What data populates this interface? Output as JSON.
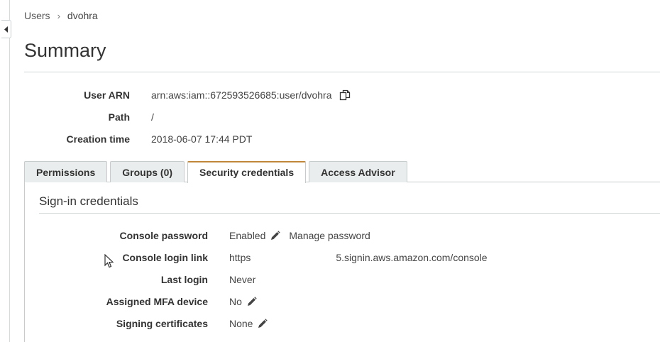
{
  "breadcrumb": {
    "root": "Users",
    "separator": "›",
    "current": "dvohra"
  },
  "page": {
    "title": "Summary"
  },
  "summary": {
    "rows": [
      {
        "label": "User ARN",
        "value": "arn:aws:iam::672593526685:user/dvohra"
      },
      {
        "label": "Path",
        "value": "/"
      },
      {
        "label": "Creation time",
        "value": "2018-06-07 17:44 PDT"
      }
    ]
  },
  "tabs": [
    {
      "label": "Permissions",
      "active": false
    },
    {
      "label": "Groups (0)",
      "active": false
    },
    {
      "label": "Security credentials",
      "active": true
    },
    {
      "label": "Access Advisor",
      "active": false
    }
  ],
  "sign_in": {
    "title": "Sign-in credentials",
    "console_password": {
      "label": "Console password",
      "value": "Enabled",
      "action": "Manage password"
    },
    "console_login_link": {
      "label": "Console login link",
      "prefix": "https",
      "suffix": "5.signin.aws.amazon.com/console"
    },
    "last_login": {
      "label": "Last login",
      "value": "Never"
    },
    "mfa_device": {
      "label": "Assigned MFA device",
      "value": "No"
    },
    "signing_certificates": {
      "label": "Signing certificates",
      "value": "None"
    }
  },
  "icons": {
    "collapse": "chevron-left-icon",
    "copy": "copy-icon",
    "edit": "pencil-icon",
    "cursor": "mouse-pointer-icon"
  },
  "colors": {
    "active_tab_accent": "#c0863a",
    "tab_background": "#eaeded",
    "rule": "#d0d5d5"
  }
}
